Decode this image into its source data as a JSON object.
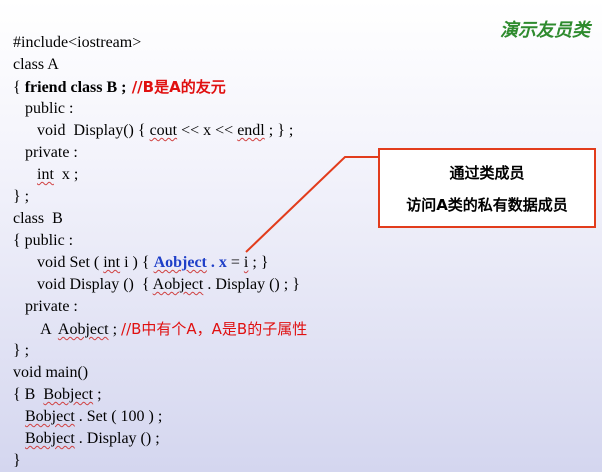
{
  "title": "演示友员类",
  "callout": {
    "line1": "通过类成员",
    "line2": "访问A类的私有数据成员"
  },
  "code": {
    "l1": "#include<iostream>",
    "l2": "class A",
    "l3_a": "{ ",
    "l3_b": "friend class B ;",
    "l3_c": " //B是A的友元",
    "l4_a": "   public :",
    "l5_a": "      void  Display() { ",
    "l5_b": "cout",
    "l5_c": " << x << ",
    "l5_d": "endl",
    "l5_e": " ; } ;",
    "l6": "   private :",
    "l7_a": "      ",
    "l7_b": "int",
    "l7_c": "  x ;",
    "l8": "} ;",
    "l9": "class  B",
    "l10": "{ public :",
    "l11_a": "      void Set ( ",
    "l11_b": "int",
    "l11_c": " i ) { ",
    "l11_d": "Aobject",
    "l11_e": " . x",
    "l11_f": " = ",
    "l11_g": "i",
    "l11_h": " ; }",
    "l12_a": "      void Display ()  { ",
    "l12_b": "Aobject",
    "l12_c": " . Display () ; }",
    "l13": "   private :",
    "l14_a": "       A  ",
    "l14_b": "Aobject",
    "l14_c": " ; ",
    "l14_d": "//B中有个A，A是B的子属性",
    "l15": "} ;",
    "l16": "void main()",
    "l17_a": "{ B  ",
    "l17_b": "Bobject",
    "l17_c": " ;",
    "l18_a": "   ",
    "l18_b": "Bobject",
    "l18_c": " . Set ( 100 ) ;",
    "l19_a": "   ",
    "l19_b": "Bobject",
    "l19_c": " . Display () ;",
    "l20": "}"
  },
  "colors": {
    "title": "#2e8b2e",
    "comment": "#e01010",
    "highlight": "#1e3fc8",
    "callout_border": "#e23c1c"
  }
}
